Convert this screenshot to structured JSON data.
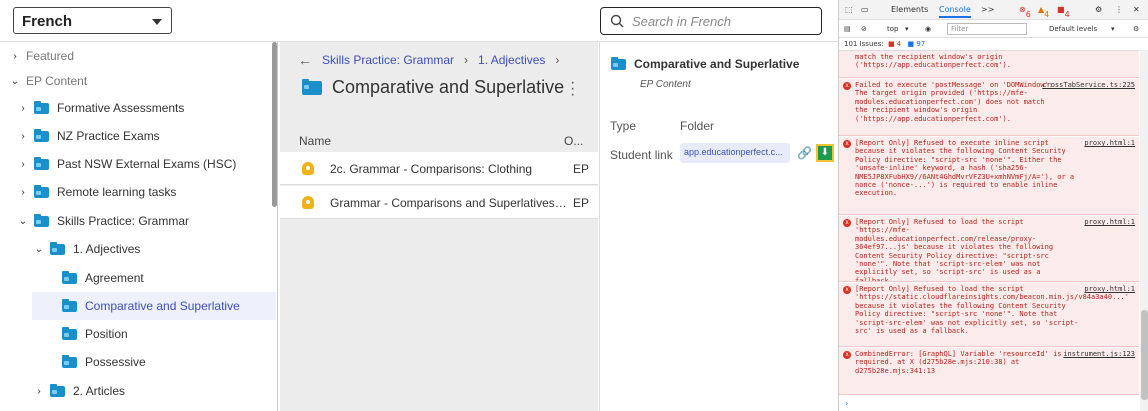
{
  "header": {
    "language": "French",
    "search_placeholder": "Search in French"
  },
  "sidebar": {
    "items": [
      {
        "label": "Featured",
        "level": 0,
        "state": "collapsed",
        "icon": "none"
      },
      {
        "label": "EP Content",
        "level": 0,
        "state": "expanded",
        "icon": "none"
      },
      {
        "label": "Formative Assessments",
        "level": 1,
        "state": "collapsed",
        "icon": "folder-icon"
      },
      {
        "label": "NZ Practice Exams",
        "level": 1,
        "state": "collapsed",
        "icon": "folder-icon"
      },
      {
        "label": "Past NSW External Exams (HSC)",
        "level": 1,
        "state": "collapsed",
        "icon": "folder-icon"
      },
      {
        "label": "Remote learning tasks",
        "level": 1,
        "state": "collapsed",
        "icon": "folder-icon"
      },
      {
        "label": "Skills Practice: Grammar",
        "level": 1,
        "state": "expanded",
        "icon": "folder-icon"
      },
      {
        "label": "1. Adjectives",
        "level": 2,
        "state": "expanded",
        "icon": "folder-icon"
      },
      {
        "label": "Agreement",
        "level": 3,
        "state": "leaf",
        "icon": "folder-icon"
      },
      {
        "label": "Comparative and Superlative",
        "level": 3,
        "state": "selected",
        "icon": "folder-icon"
      },
      {
        "label": "Position",
        "level": 3,
        "state": "leaf",
        "icon": "folder-icon"
      },
      {
        "label": "Possessive",
        "level": 3,
        "state": "leaf",
        "icon": "folder-icon"
      },
      {
        "label": "2. Articles",
        "level": 2,
        "state": "collapsed",
        "icon": "folder-icon"
      }
    ]
  },
  "main": {
    "breadcrumbs": [
      "Skills Practice: Grammar",
      "1. Adjectives"
    ],
    "title": "Comparative and Superlative",
    "columns": {
      "name": "Name",
      "owner": "O..."
    },
    "rows": [
      {
        "name": "2c. Grammar - Comparisons: Clothing",
        "owner": "EP"
      },
      {
        "name": "Grammar - Comparisons and Superlatives: Places",
        "owner": "EP"
      }
    ]
  },
  "detail": {
    "title": "Comparative and Superlative",
    "subtitle": "EP Content",
    "type_label": "Type",
    "type_value": "Folder",
    "link_label": "Student link",
    "link_value": "app.educationperfect.c..."
  },
  "devtools": {
    "tabs": [
      "Elements",
      "Console",
      ">>"
    ],
    "active_tab": "Console",
    "error_count": "6",
    "warning_count": "4",
    "info_count": "4",
    "context": "top",
    "filter_placeholder": "Filter",
    "levels": "Default levels",
    "issues_text": "101 Issues:",
    "issues_err": "4",
    "issues_info": "97",
    "logs": [
      {
        "text": "match the recipient window's origin ('https://app.educationperfect.com').",
        "source": ""
      },
      {
        "text": "Failed to execute 'postMessage' on 'DOMWindow': The target origin provided ('https://mfe-modules.educationperfect.com') does not match the recipient window's origin ('https://app.educationperfect.com').",
        "source": "crossTabService.ts:225"
      },
      {
        "text": "[Report Only] Refused to execute inline script because it violates the following Content Security Policy directive: \"script-src 'none'\". Either the 'unsafe-inline' keyword, a hash ('sha256-NME5JP8XFubHX9//6ANt4GhdMvrVFZ3U+xmhNVmFj/A='), or a nonce ('nonce-...') is required to enable inline execution.",
        "source": "proxy.html:1"
      },
      {
        "text": "[Report Only] Refused to load the script 'https://mfe-modules.educationperfect.com/release/proxy-364ef97...js' because it violates the following Content Security Policy directive: \"script-src 'none'\". Note that 'script-src-elem' was not explicitly set, so 'script-src' is used as a fallback.",
        "source": "proxy.html:1"
      },
      {
        "text": "[Report Only] Refused to load the script 'https://static.cloudflareinsights.com/beacon.min.js/v84a3a40...' because it violates the following Content Security Policy directive: \"script-src 'none'\". Note that 'script-src-elem' was not explicitly set, so 'script-src' is used as a fallback.",
        "source": "proxy.html:1"
      },
      {
        "text": "CombinedError: [GraphQL] Variable 'resourceId' is required. at X (d275b28e.mjs:210:38) at d275b28e.mjs:341:13",
        "source": "instrument.js:123"
      }
    ]
  },
  "colors": {
    "accent": "#3d4fb5",
    "folder": "#1a8fc9",
    "selected_bg": "#eef0fb",
    "error_bg": "#fcebeb",
    "error_text": "#b3261e"
  }
}
